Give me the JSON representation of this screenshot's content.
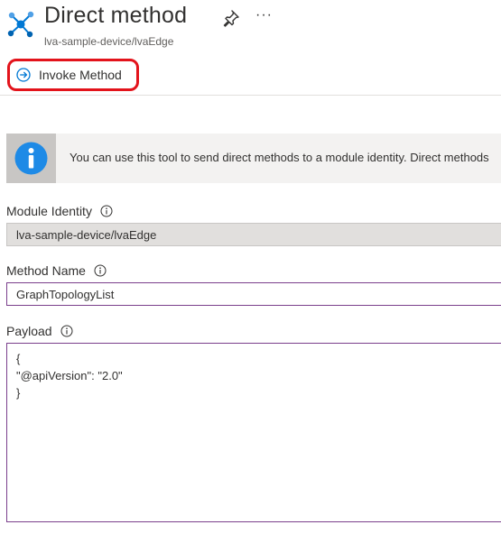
{
  "header": {
    "title": "Direct method",
    "subtitle": "lva-sample-device/lvaEdge",
    "icons": {
      "app": "network-nodes-icon",
      "pin": "pin-icon",
      "more": "more-icon"
    },
    "more_glyph": "···"
  },
  "toolbar": {
    "invoke_label": "Invoke Method",
    "invoke_icon": "arrow-circle-right-icon"
  },
  "info": {
    "text": "You can use this tool to send direct methods to a module identity. Direct methods"
  },
  "form": {
    "module_identity": {
      "label": "Module Identity",
      "value": "lva-sample-device/lvaEdge"
    },
    "method_name": {
      "label": "Method Name",
      "value": "GraphTopologyList"
    },
    "payload": {
      "label": "Payload",
      "lines": [
        "{",
        "\"@apiVersion\": \"2.0\"",
        "}"
      ]
    }
  },
  "colors": {
    "accent": "#0078d4",
    "highlight_ring": "#e3131b",
    "focus_border": "#7b3f8c",
    "disabled_bg": "#e1dfdd"
  }
}
